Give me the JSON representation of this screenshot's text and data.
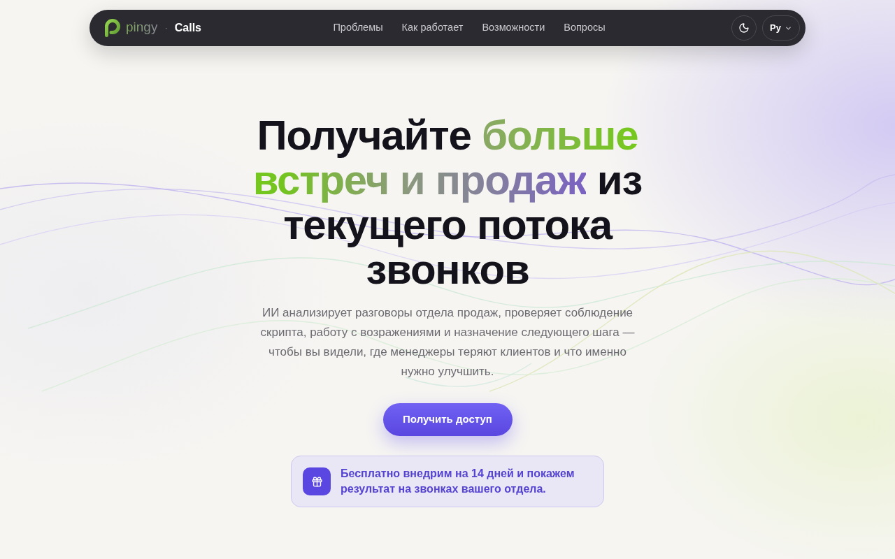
{
  "nav": {
    "logo": {
      "brand": "pingy",
      "separator": "·",
      "product": "Calls"
    },
    "links": [
      {
        "label": "Проблемы"
      },
      {
        "label": "Как работает"
      },
      {
        "label": "Возможности"
      },
      {
        "label": "Вопросы"
      }
    ],
    "language": {
      "label": "Ру"
    }
  },
  "hero": {
    "headline": [
      {
        "text": "Получайте ",
        "highlight": false
      },
      {
        "text": "больше встреч и продаж",
        "highlight": true
      },
      {
        "text": " из текущего потока звонков",
        "highlight": false
      }
    ],
    "description": "ИИ анализирует разговоры отдела продаж, проверяет соблюдение скрипта, работу с возражениями и назначение следующего шага — чтобы вы видели, где менеджеры теряют клиентов и что именно нужно улучшить.",
    "cta": {
      "label": "Получить доступ"
    },
    "offer": {
      "text": "Бесплатно внедрим на 14 дней и покажем результат на звонках вашего отдела."
    }
  }
}
